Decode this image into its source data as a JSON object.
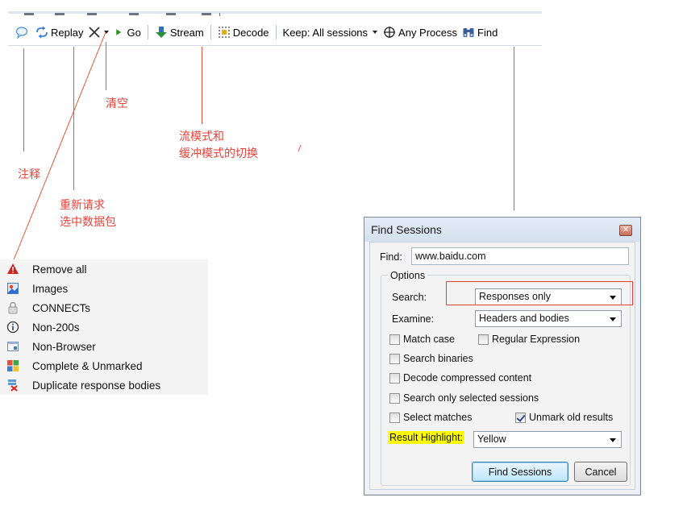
{
  "toolbar": {
    "replay": "Replay",
    "go": "Go",
    "stream": "Stream",
    "decode": "Decode",
    "keep": "Keep: All sessions",
    "any_process": "Any Process",
    "find": "Find"
  },
  "annotations": {
    "clear": "清空",
    "stream_mode_line1": "流模式和",
    "stream_mode_line2": "缓冲模式的切换",
    "comment": "注释",
    "replay_line1": "重新请求",
    "replay_line2": "选中数据包"
  },
  "filter_menu": {
    "items": [
      {
        "label": "Remove all",
        "icon": "remove-all-icon"
      },
      {
        "label": "Images",
        "icon": "images-icon"
      },
      {
        "label": "CONNECTs",
        "icon": "lock-icon"
      },
      {
        "label": "Non-200s",
        "icon": "info-icon"
      },
      {
        "label": "Non-Browser",
        "icon": "non-browser-icon"
      },
      {
        "label": "Complete & Unmarked",
        "icon": "complete-unmarked-icon"
      },
      {
        "label": "Duplicate response bodies",
        "icon": "duplicate-icon"
      }
    ]
  },
  "dialog": {
    "title": "Find Sessions",
    "find_label": "Find:",
    "find_value": "www.baidu.com",
    "options_legend": "Options",
    "search_label": "Search:",
    "search_value": "Responses only",
    "examine_label": "Examine:",
    "examine_value": "Headers and bodies",
    "match_case": "Match case",
    "regex": "Regular Expression",
    "search_binaries": "Search binaries",
    "decode_compressed": "Decode compressed content",
    "search_selected": "Search only selected sessions",
    "select_matches": "Select matches",
    "unmark_old": "Unmark old results",
    "result_highlight_label": "Result Highlight:",
    "result_highlight_value": "Yellow",
    "find_button": "Find Sessions",
    "cancel_button": "Cancel"
  },
  "colors": {
    "annotation": "#e8423a",
    "highlight": "#ffff00"
  }
}
